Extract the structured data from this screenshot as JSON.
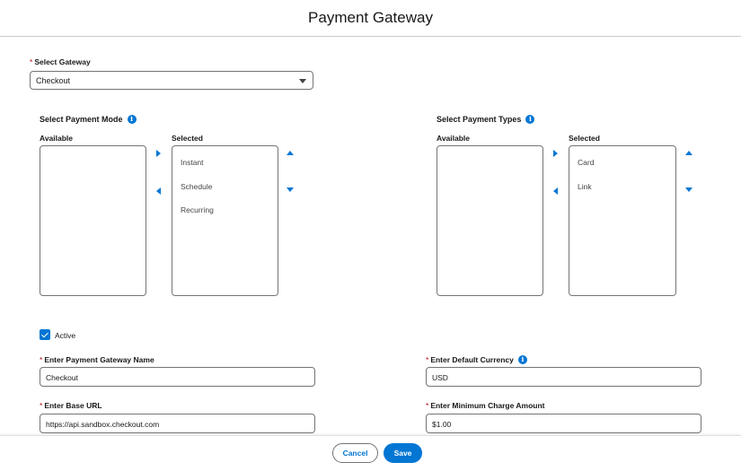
{
  "header": {
    "title": "Payment Gateway"
  },
  "gateway": {
    "label": "Select Gateway",
    "required_mark": "*",
    "value": "Checkout",
    "icon": "chevron-down-icon"
  },
  "payment_mode": {
    "title": "Select Payment Mode",
    "info_icon": "i",
    "available_label": "Available",
    "selected_label": "Selected",
    "available_items": [],
    "selected_items": [
      "Instant",
      "Schedule",
      "Recurring"
    ]
  },
  "payment_types": {
    "title": "Select Payment Types",
    "info_icon": "i",
    "available_label": "Available",
    "selected_label": "Selected",
    "available_items": [],
    "selected_items": [
      "Card",
      "Link"
    ]
  },
  "active": {
    "label": "Active",
    "checked": true
  },
  "fields": {
    "gateway_name": {
      "label": "Enter Payment Gateway Name",
      "required_mark": "*",
      "value": "Checkout"
    },
    "base_url": {
      "label": "Enter Base URL",
      "required_mark": "*",
      "value": "https://api.sandbox.checkout.com"
    },
    "default_currency": {
      "label": "Enter Default Currency",
      "required_mark": "*",
      "value": "USD",
      "info_icon": "i"
    },
    "min_charge": {
      "label": "Enter Minimum Charge Amount",
      "required_mark": "*",
      "value": "$1.00"
    }
  },
  "footer": {
    "cancel_label": "Cancel",
    "save_label": "Save"
  },
  "colors": {
    "brand": "#0176d3",
    "required": "#ba0517",
    "border": "#747474"
  }
}
